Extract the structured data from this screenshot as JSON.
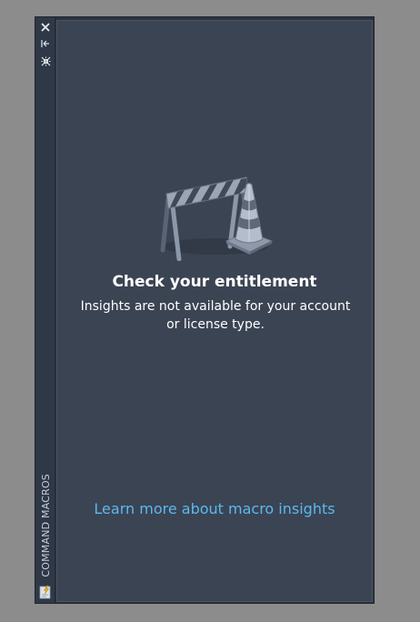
{
  "palette": {
    "title": "COMMAND MACROS",
    "buttons": {
      "close_icon": "close-icon",
      "autohide_icon": "auto-hide-icon",
      "properties_icon": "properties-icon",
      "menu_icon": "palette-menu-icon"
    }
  },
  "main": {
    "heading": "Check your entitlement",
    "message": "Insights are not available for your account or license type.",
    "link": "Learn more about macro insights",
    "illustration_icon": "construction-barrier-cone-icon"
  },
  "colors": {
    "panel_bg": "#3b4453",
    "titlebar_bg": "#2f3846",
    "link": "#5cb8ee",
    "text": "#ffffff",
    "desktop_bg": "#8c8c8c"
  }
}
